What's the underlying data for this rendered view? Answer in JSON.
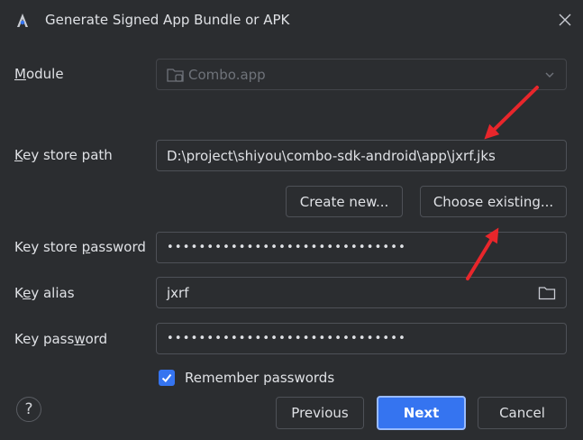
{
  "dialog": {
    "title": "Generate Signed App Bundle or APK"
  },
  "form": {
    "module": {
      "label_mnemonic": "M",
      "label_rest": "odule",
      "value": "Combo.app"
    },
    "key_store_path": {
      "label_mnemonic": "K",
      "label_rest": "ey store path",
      "value": "D:\\project\\shiyou\\combo-sdk-android\\app\\jxrf.jks"
    },
    "create_new_label": "Create new...",
    "choose_existing_label": "Choose existing...",
    "key_store_password": {
      "label_pre": "Key store ",
      "label_mnemonic": "p",
      "label_rest": "assword",
      "value": "••••••••••••••••••••••••••••••"
    },
    "key_alias": {
      "label_pre": "K",
      "label_mnemonic": "e",
      "label_rest": "y alias",
      "value": "jxrf"
    },
    "key_password": {
      "label_pre": "Key pass",
      "label_mnemonic": "w",
      "label_rest": "ord",
      "value": "••••••••••••••••••••••••••••••"
    },
    "remember_passwords": {
      "label": "Remember passwords",
      "checked": true
    }
  },
  "footer": {
    "help_label": "?",
    "previous_label": "Previous",
    "next_label": "Next",
    "cancel_label": "Cancel"
  },
  "colors": {
    "background": "#2b2d30",
    "accent": "#3574f0",
    "annotation_arrow": "#e8262b"
  },
  "icons": [
    "android-studio-icon",
    "close-icon",
    "module-folder-icon",
    "chevron-down-icon",
    "folder-icon",
    "checkmark-icon",
    "help-icon",
    "red-arrow-annotation"
  ]
}
